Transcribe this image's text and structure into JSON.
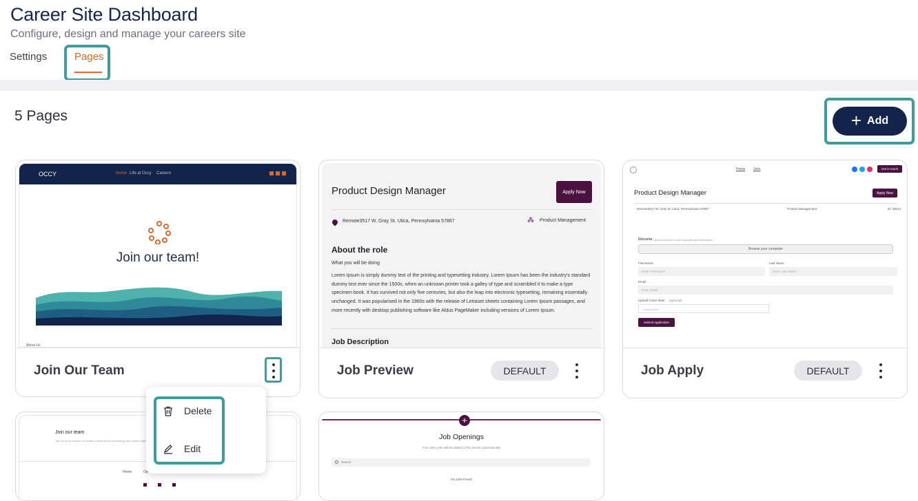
{
  "header": {
    "title": "Career Site Dashboard",
    "subtitle": "Configure, design and manage your careers site"
  },
  "tabs": {
    "settings": "Settings",
    "pages": "Pages"
  },
  "toolbar": {
    "count_label": "5 Pages",
    "add_label": "Add"
  },
  "cards": [
    {
      "name": "Join Our Team",
      "badge": ""
    },
    {
      "name": "Job Preview",
      "badge": "DEFAULT"
    },
    {
      "name": "Job Apply",
      "badge": "DEFAULT"
    }
  ],
  "menu": {
    "delete": "Delete",
    "edit": "Edit"
  },
  "preview_join": {
    "logo": "OCCY",
    "nav": [
      "Home",
      "Life at Occy",
      "Careers"
    ],
    "heading": "Join our team!",
    "footer": "About Us"
  },
  "preview_job": {
    "title": "Product Design Manager",
    "apply": "Apply Now",
    "location": "Remote3517 W. Gray St. Utica, Pennsylvania 57867",
    "dept": "Product Management",
    "about": "About the role",
    "what": "What you will be doing",
    "body": "Lorem Ipsum is simply dummy text of the printing and typesetting industry. Lorem Ipsum has been the industry's standard dummy text ever since the 1500s, when an unknown printer took a galley of type and scrambled it to make a type specimen book. It has survived not only five centuries, but also the leap into electronic typesetting, remaining essentially unchanged. It was popularised in the 1960s with the release of Letraset sheets containing Lorem Ipsum passages, and more recently with desktop publishing software like Aldus PageMaker including versions of Lorem Ipsum.",
    "desc": "Job Description"
  },
  "preview_apply": {
    "nav": [
      "Home",
      "Jobs"
    ],
    "cta": "Get in touch",
    "title": "Product Design Manager",
    "apply": "Apply Now",
    "location": "Remote3517 W. Gray St. Utica, Pennsylvania 57867",
    "dept": "Product Management",
    "id": "ID: 39412",
    "resume": "Resume",
    "resume_hint": "Upload resume to auto populate your information",
    "browse": "Browse your computer",
    "first": "First Name",
    "first_ph": "Enter First Name",
    "last": "Last Name",
    "last_ph": "Enter Last Name",
    "email": "Email",
    "email_ph": "Enter Email",
    "cover": "Upload Cover letter",
    "cover_opt": "(optional)",
    "cover_ph": "Upload Here",
    "submit": "Submit Application"
  },
  "preview_team": {
    "heading": "Join our team",
    "text": "Join us in our mission to create a world where technology and human ingenuity...",
    "links": [
      "Home",
      "Op"
    ]
  },
  "preview_openings": {
    "heading": "Job Openings",
    "sub": "Your open jobs will be added to this section automatically",
    "search": "Search",
    "empty": "No Jobs Found"
  },
  "colors": {
    "accent": "#d9682b",
    "navy": "#13244a",
    "highlight": "#3e9c99",
    "purple": "#4b1240"
  }
}
